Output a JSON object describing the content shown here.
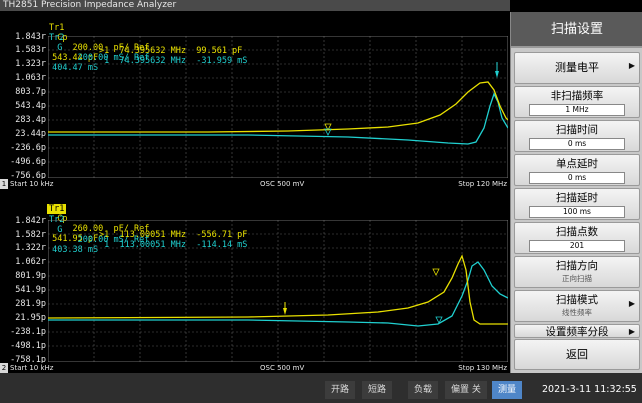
{
  "app": {
    "title": "TH2851 Precision Impedance Analyzer"
  },
  "panel1": {
    "tr1": {
      "label": "Tr1",
      "param": "Cp",
      "scale": "200.00  pF/ Ref",
      "ref": "543.44 pF"
    },
    "tr2": {
      "label": "Tr2",
      "param": "G",
      "scale": "200.00 mS/ Ref",
      "ref": "404.47 mS"
    },
    "marker": {
      "num": ">1",
      "freq1": "74.395632 MHz",
      "val1": "99.561 pF",
      "num2": "1",
      "freq2": "74.395632 MHz",
      "val2": "-31.959 mS"
    },
    "ylabels": [
      "1.843r",
      "1.583r",
      "1.323r",
      "1.063r",
      "803.7p",
      "543.4p",
      "283.4p",
      "23.44p",
      "-236.6p",
      "-496.6p",
      "-756.6p"
    ],
    "footer": {
      "num": "1",
      "start": "Start 10 kHz",
      "osc": "OSC 500 mV",
      "stop": "Stop 120 MHz"
    }
  },
  "panel2": {
    "tr1": {
      "label": "Tr1",
      "param": "Cp",
      "scale": "260.00  pF/ Ref",
      "ref": "541.95 pF"
    },
    "tr2": {
      "label": "Tr2",
      "param": "G",
      "scale": "200.00 mS/ Ref",
      "ref": "403.38 mS"
    },
    "marker": {
      "num": ">1",
      "freq1": "113.00051 MHz",
      "val1": "-556.71 pF",
      "num2": "1",
      "freq2": "113.00051 MHz",
      "val2": "-114.14 mS"
    },
    "ylabels": [
      "1.842r",
      "1.582r",
      "1.322r",
      "1.062r",
      "801.9p",
      "541.9p",
      "281.9p",
      "21.95p",
      "-238.1p",
      "-498.1p",
      "-758.1p"
    ],
    "footer": {
      "num": "2",
      "start": "Start 10 kHz",
      "osc": "OSC 500 mV",
      "stop": "Stop 130 MHz"
    }
  },
  "sidebar": {
    "title": "扫描设置",
    "buttons": [
      {
        "label": "测量电平",
        "value": "",
        "arrow": "▶"
      },
      {
        "label": "非扫描频率",
        "value": "1 MHz"
      },
      {
        "label": "扫描时间",
        "value": "0 ms"
      },
      {
        "label": "单点延时",
        "value": "0 ms"
      },
      {
        "label": "扫描延时",
        "value": "100 ms"
      },
      {
        "label": "扫描点数",
        "value": "201"
      },
      {
        "label": "扫描方向",
        "value": "正向扫描"
      },
      {
        "label": "扫描模式",
        "value": "线性频率",
        "arrow": "▶"
      },
      {
        "label": "设置频率分段",
        "value": "",
        "arrow": "▶"
      },
      {
        "label": "返回",
        "value": ""
      }
    ]
  },
  "statusbar": {
    "buttons": [
      "开路",
      "短路",
      "负载",
      "偏置 关",
      "测量"
    ],
    "datetime": "2021-3-11 11:32:55"
  },
  "colors": {
    "trace1": "#e8e000",
    "trace2": "#20d0d0",
    "grid": "#5a5a5a",
    "accent": "#4f86c8"
  }
}
